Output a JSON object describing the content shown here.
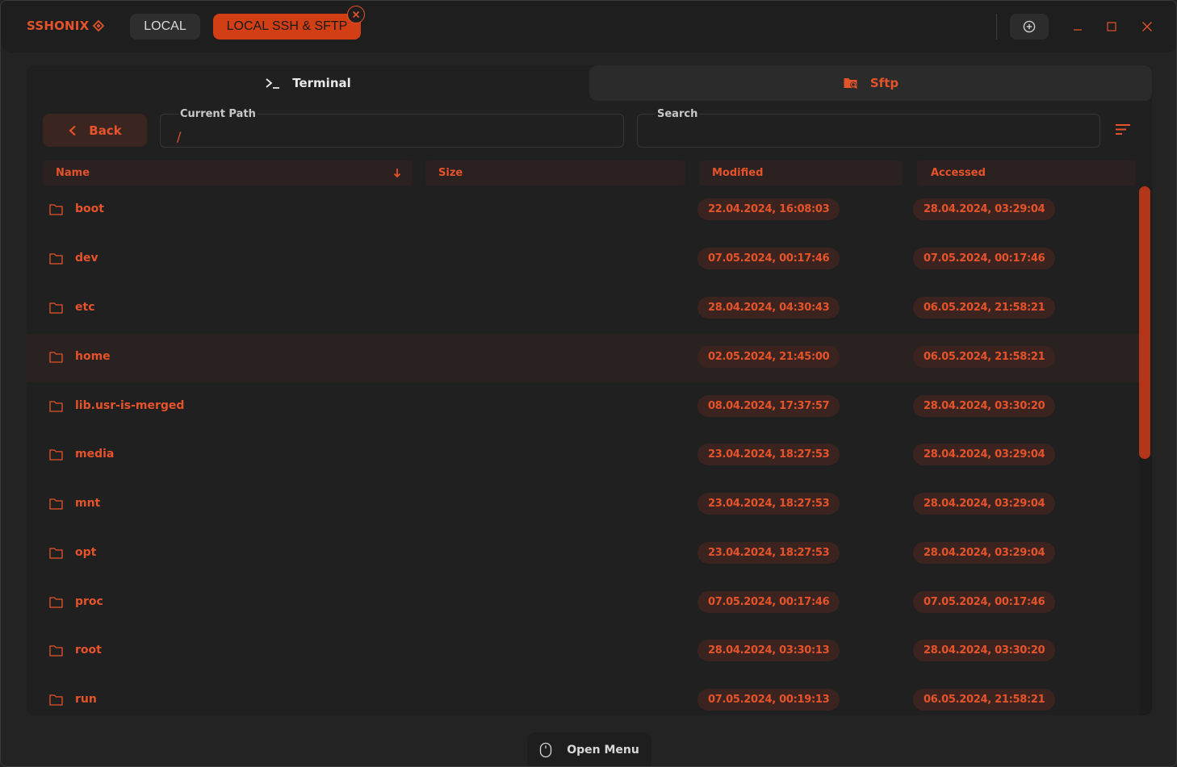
{
  "app": {
    "brand": "SSHONIX"
  },
  "tabs": [
    {
      "label": "LOCAL",
      "active": false
    },
    {
      "label": "LOCAL SSH & SFTP",
      "active": true
    }
  ],
  "modes": {
    "terminal": "Terminal",
    "sftp": "Sftp"
  },
  "toolbar": {
    "back_label": "Back",
    "path_label": "Current Path",
    "path_value": "/",
    "search_label": "Search",
    "search_value": ""
  },
  "columns": {
    "name": "Name",
    "size": "Size",
    "modified": "Modified",
    "accessed": "Accessed"
  },
  "rows": [
    {
      "name": "boot",
      "modified": "22.04.2024, 16:08:03",
      "accessed": "28.04.2024, 03:29:04"
    },
    {
      "name": "dev",
      "modified": "07.05.2024, 00:17:46",
      "accessed": "07.05.2024, 00:17:46"
    },
    {
      "name": "etc",
      "modified": "28.04.2024, 04:30:43",
      "accessed": "06.05.2024, 21:58:21"
    },
    {
      "name": "home",
      "modified": "02.05.2024, 21:45:00",
      "accessed": "06.05.2024, 21:58:21",
      "hover": true
    },
    {
      "name": "lib.usr-is-merged",
      "modified": "08.04.2024, 17:37:57",
      "accessed": "28.04.2024, 03:30:20"
    },
    {
      "name": "media",
      "modified": "23.04.2024, 18:27:53",
      "accessed": "28.04.2024, 03:29:04"
    },
    {
      "name": "mnt",
      "modified": "23.04.2024, 18:27:53",
      "accessed": "28.04.2024, 03:29:04"
    },
    {
      "name": "opt",
      "modified": "23.04.2024, 18:27:53",
      "accessed": "28.04.2024, 03:29:04"
    },
    {
      "name": "proc",
      "modified": "07.05.2024, 00:17:46",
      "accessed": "07.05.2024, 00:17:46"
    },
    {
      "name": "root",
      "modified": "28.04.2024, 03:30:13",
      "accessed": "28.04.2024, 03:30:20"
    },
    {
      "name": "run",
      "modified": "07.05.2024, 00:19:13",
      "accessed": "06.05.2024, 21:58:21"
    }
  ],
  "footer": {
    "open_menu": "Open Menu"
  },
  "colors": {
    "accent": "#e5532a",
    "background": "#232323",
    "badge_bg": "#3b2420"
  },
  "icons": [
    "diamond-icon",
    "close-icon",
    "add-circle-icon",
    "minimize-icon",
    "maximize-icon",
    "terminal-icon",
    "folder-search-icon",
    "chevron-left-icon",
    "filter-icon",
    "sort-down-icon",
    "folder-icon",
    "mouse-icon"
  ]
}
